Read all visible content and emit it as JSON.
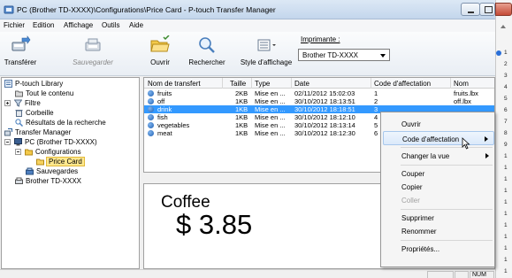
{
  "window": {
    "title": "PC (Brother TD-XXXX)\\Configurations\\Price Card - P-touch Transfer Manager"
  },
  "menu": [
    "Fichier",
    "Edition",
    "Affichage",
    "Outils",
    "Aide"
  ],
  "toolbar": {
    "transfer_label": "Transférer",
    "save_label": "Sauvegarder",
    "open_label": "Ouvrir",
    "search_label": "Rechercher",
    "style_label": "Style d'affichage",
    "printer_label": "Imprimante :",
    "printer_value": "Brother TD-XXXX"
  },
  "tree": {
    "items": [
      {
        "label": "P-touch Library",
        "icon": "library-icon"
      },
      {
        "label": "Tout le contenu",
        "icon": "folder-icon"
      },
      {
        "label": "Filtre",
        "icon": "filter-icon"
      },
      {
        "label": "Corbeille",
        "icon": "trash-icon"
      },
      {
        "label": "Résultats de la recherche",
        "icon": "search-results-icon"
      },
      {
        "label": "Transfer Manager",
        "icon": "transfer-manager-icon"
      },
      {
        "label": "PC (Brother TD-XXXX)",
        "icon": "computer-icon"
      },
      {
        "label": "Configurations",
        "icon": "folder-icon"
      },
      {
        "label": "Price Card",
        "icon": "folder-open-icon"
      },
      {
        "label": "Sauvegardes",
        "icon": "backup-icon"
      },
      {
        "label": "Brother TD-XXXX",
        "icon": "printer-icon"
      }
    ]
  },
  "table": {
    "columns": [
      "Nom de transfert",
      "Taille",
      "Type",
      "Date",
      "Code d'affectation",
      "Nom"
    ],
    "rows": [
      {
        "name": "fruits",
        "size": "2KB",
        "type": "Mise en ...",
        "date": "02/11/2012 15:02:03",
        "code": "1",
        "file": "fruits.lbx"
      },
      {
        "name": "off",
        "size": "1KB",
        "type": "Mise en ...",
        "date": "30/10/2012 18:13:51",
        "code": "2",
        "file": "off.lbx"
      },
      {
        "name": "drink",
        "size": "1KB",
        "type": "Mise en ...",
        "date": "30/10/2012 18:18:51",
        "code": "3",
        "file": ""
      },
      {
        "name": "fish",
        "size": "1KB",
        "type": "Mise en ...",
        "date": "30/10/2012 18:12:10",
        "code": "4",
        "file": ""
      },
      {
        "name": "vegetables",
        "size": "1KB",
        "type": "Mise en ...",
        "date": "30/10/2012 18:13:14",
        "code": "5",
        "file": ""
      },
      {
        "name": "meat",
        "size": "1KB",
        "type": "Mise en ...",
        "date": "30/10/2012 18:12:30",
        "code": "6",
        "file": ""
      }
    ],
    "selected_row": 2
  },
  "preview": {
    "line1": "Coffee",
    "line2": "$ 3.85"
  },
  "context_menu": {
    "items": [
      {
        "label": "Ouvrir",
        "submenu": false,
        "disabled": false
      },
      {
        "label": "Code d'affectation",
        "submenu": true,
        "disabled": false,
        "highlighted": true
      },
      {
        "label": "Changer la vue",
        "submenu": true,
        "disabled": false
      },
      {
        "label": "Couper",
        "submenu": false,
        "disabled": false
      },
      {
        "label": "Copier",
        "submenu": false,
        "disabled": false
      },
      {
        "label": "Coller",
        "submenu": false,
        "disabled": true
      },
      {
        "label": "Supprimer",
        "submenu": false,
        "disabled": false
      },
      {
        "label": "Renommer",
        "submenu": false,
        "disabled": false
      },
      {
        "label": "Propriétés...",
        "submenu": false,
        "disabled": false
      }
    ]
  },
  "status": {
    "num": "NUM"
  },
  "right_strip": {
    "numbers": [
      "1",
      "2",
      "3",
      "4",
      "5",
      "6",
      "7",
      "8",
      "9",
      "1",
      "1",
      "1",
      "1",
      "1",
      "1",
      "1",
      "1",
      "1",
      "1",
      "1"
    ]
  }
}
